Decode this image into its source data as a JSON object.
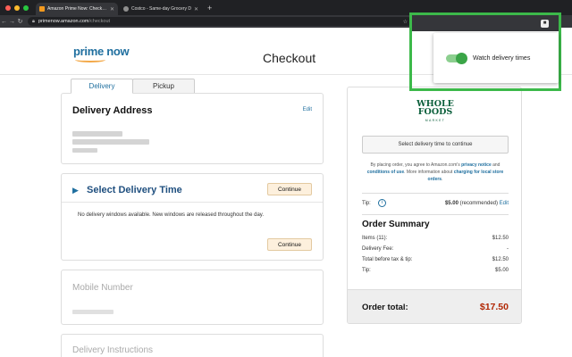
{
  "browser": {
    "dot_colors": [
      "#ff5f57",
      "#febc2e",
      "#28c840"
    ],
    "tabs": [
      {
        "label": "Amazon Prime Now: Checkout",
        "favicon_color": "#f39a1f",
        "active": true
      },
      {
        "label": "Costco - Same-day Grocery D",
        "favicon_color": "#8f8f8f",
        "active": false
      }
    ],
    "new_tab": "+",
    "url_host": "primenow.amazon.com",
    "url_path": "/checkout"
  },
  "header": {
    "logo_prime": "prime",
    "logo_now": "now",
    "page_title": "Checkout"
  },
  "tabs": {
    "delivery": "Delivery",
    "pickup": "Pickup"
  },
  "address": {
    "title": "Delivery Address",
    "edit": "Edit"
  },
  "delivery_time": {
    "title": "Select Delivery Time",
    "continue": "Continue",
    "message": "No delivery windows available. New windows are released throughout the day.",
    "continue2": "Continue"
  },
  "mobile": {
    "title": "Mobile Number"
  },
  "instructions": {
    "title": "Delivery Instructions"
  },
  "panel": {
    "store_logo_top": "WHOLE",
    "store_logo_mid": "FOODS",
    "store_logo_sub": "MARKET",
    "select_button": "Select delivery time to continue",
    "legal_1": "By placing order, you agree to Amazon.com's ",
    "legal_privacy": "privacy notice",
    "legal_and": " and ",
    "legal_conditions": "conditions of use",
    "legal_2": ". More information about ",
    "legal_charging": "charging for local store orders",
    "legal_end": ".",
    "tip_label": "Tip:",
    "tip_value": "$5.00",
    "tip_rec": " (recommended) ",
    "tip_edit": "Edit",
    "summary_title": "Order Summary",
    "rows": [
      {
        "label": "Items (11):",
        "value": "$12.50"
      },
      {
        "label": "Delivery Fee:",
        "value": "-"
      },
      {
        "label": "Total before tax & tip:",
        "value": "$12.50"
      },
      {
        "label": "Tip:",
        "value": "$5.00"
      }
    ],
    "total_label": "Order total:",
    "total_value": "$17.50"
  },
  "extension": {
    "toggle_on": true,
    "label": "Watch delivery times",
    "highlight_color": "#3cb94a"
  }
}
